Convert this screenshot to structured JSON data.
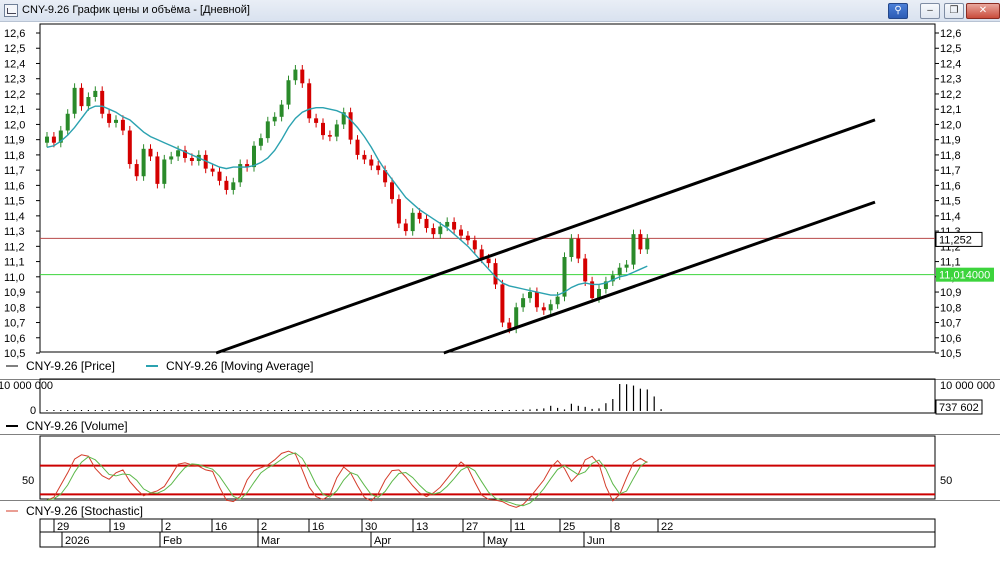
{
  "window": {
    "title": "CNY-9.26 График цены и объёма - [Дневной]",
    "buttons": {
      "pin": "⚲",
      "min": "–",
      "restore": "❐",
      "close": "✕"
    }
  },
  "colors": {
    "up": "#2a8a2a",
    "down": "#d40000",
    "ma": "#2ba2b0",
    "price_line": "#b84a4a",
    "level_line": "#3cd43c",
    "channel": "#000000",
    "stoch_k": "#d43c2a",
    "stoch_d": "#5cb84a",
    "stoch_bands": "#cc0000"
  },
  "price_panel": {
    "y_ticks": [
      "12,6",
      "12,5",
      "12,4",
      "12,3",
      "12,2",
      "12,1",
      "12,0",
      "11,9",
      "11,8",
      "11,7",
      "11,6",
      "11,5",
      "11,4",
      "11,3",
      "11,2",
      "11,1",
      "11,0",
      "10,9",
      "10,8",
      "10,7",
      "10,6",
      "10,5"
    ],
    "last_price_label": "11,252",
    "last_price": 11.252,
    "level_label": "11,014000",
    "level": 11.014,
    "ylim": [
      10.5,
      12.6
    ],
    "legend_price": "CNY-9.26 [Price]",
    "legend_ma": "CNY-9.26 [Moving Average]"
  },
  "volume_panel": {
    "top_label": "10 000 000",
    "zero_label": "0",
    "right_top_label": "10 000 000",
    "last_volume_label": "737 602",
    "legend": "CNY-9.26 [Volume]"
  },
  "stoch_panel": {
    "left_label": "50",
    "right_label": "50",
    "bands": [
      70,
      30
    ],
    "legend": "CNY-9.26 [Stochastic]"
  },
  "date_axis": {
    "days": [
      "29",
      "19",
      "2",
      "16",
      "2",
      "16",
      "30",
      "13",
      "27",
      "11",
      "25",
      "8",
      "22"
    ],
    "months": [
      "2026",
      "Feb",
      "Mar",
      "Apr",
      "May",
      "Jun"
    ]
  },
  "chart_data": {
    "type": "candlestick",
    "x_unit": "trading day",
    "closes": [
      11.92,
      11.88,
      11.96,
      12.07,
      12.24,
      12.12,
      12.18,
      12.22,
      12.07,
      12.01,
      12.03,
      11.96,
      11.74,
      11.66,
      11.84,
      11.79,
      11.61,
      11.77,
      11.79,
      11.83,
      11.78,
      11.76,
      11.8,
      11.71,
      11.69,
      11.63,
      11.57,
      11.62,
      11.74,
      11.72,
      11.86,
      11.91,
      12.02,
      12.05,
      12.13,
      12.29,
      12.36,
      12.27,
      12.04,
      12.01,
      11.93,
      11.92,
      12.0,
      12.08,
      11.9,
      11.8,
      11.77,
      11.73,
      11.7,
      11.62,
      11.51,
      11.35,
      11.3,
      11.42,
      11.38,
      11.32,
      11.28,
      11.33,
      11.36,
      11.31,
      11.27,
      11.24,
      11.18,
      11.12,
      11.09,
      10.95,
      10.7,
      10.66,
      10.8,
      10.86,
      10.9,
      10.8,
      10.78,
      10.82,
      10.87,
      11.13,
      11.25,
      11.12,
      10.97,
      10.86,
      10.92,
      10.97,
      11.01,
      11.06,
      11.08,
      11.28,
      11.18,
      11.25
    ],
    "moving_average": [
      11.85,
      11.86,
      11.89,
      11.93,
      11.98,
      12.04,
      12.1,
      12.12,
      12.12,
      12.1,
      12.08,
      12.05,
      12.03,
      11.99,
      11.95,
      11.92,
      11.9,
      11.88,
      11.86,
      11.84,
      11.82,
      11.8,
      11.78,
      11.76,
      11.74,
      11.72,
      11.71,
      11.72,
      11.72,
      11.72,
      11.73,
      11.75,
      11.78,
      11.83,
      11.9,
      11.98,
      12.04,
      12.08,
      12.1,
      12.11,
      12.11,
      12.1,
      12.09,
      12.07,
      12.03,
      11.98,
      11.92,
      11.85,
      11.77,
      11.7,
      11.64,
      11.58,
      11.52,
      11.48,
      11.44,
      11.41,
      11.38,
      11.35,
      11.32,
      11.28,
      11.24,
      11.2,
      11.15,
      11.1,
      11.05,
      11.0,
      10.96,
      10.94,
      10.93,
      10.92,
      10.91,
      10.9,
      10.89,
      10.88,
      10.88,
      10.9,
      10.93,
      10.95,
      10.96,
      10.95,
      10.95,
      10.96,
      10.98,
      11.0,
      11.01,
      11.03,
      11.05,
      11.07
    ],
    "channel_upper": [
      [
        24.5,
        10.5
      ],
      [
        120,
        12.03
      ]
    ],
    "channel_lower": [
      [
        57.5,
        10.5
      ],
      [
        120,
        11.49
      ]
    ],
    "volume": [
      0,
      0,
      0,
      0,
      0,
      0,
      0,
      0,
      0,
      0,
      0,
      0,
      0,
      0,
      0,
      0,
      0,
      0,
      0,
      0,
      0,
      0,
      0,
      0,
      0,
      0,
      0,
      0,
      0,
      0,
      0,
      0,
      0,
      0,
      0,
      0,
      0,
      0,
      0,
      0,
      0,
      0,
      0,
      0,
      0,
      0,
      0,
      0,
      0,
      0,
      0,
      0.2,
      0.2,
      0.2,
      0.2,
      0.2,
      0.2,
      0.2,
      0.2,
      0.2,
      0.2,
      0.3,
      0.3,
      0.3,
      0.3,
      0.3,
      0.3,
      0.3,
      0.4,
      0.5,
      0.6,
      0.8,
      1.0,
      2.0,
      1.2,
      0.6,
      2.8,
      2.0,
      1.6,
      0.8,
      1.0,
      3.0,
      4.6,
      10.4,
      10.3,
      9.8,
      8.6,
      8.3,
      5.6,
      0.7
    ],
    "stochastic_k": [
      22,
      26,
      43,
      60,
      79,
      85,
      83,
      66,
      56,
      51,
      60,
      64,
      48,
      37,
      28,
      32,
      35,
      41,
      56,
      72,
      74,
      71,
      69,
      64,
      62,
      40,
      22,
      20,
      27,
      50,
      63,
      67,
      71,
      78,
      87,
      90,
      86,
      64,
      40,
      27,
      23,
      29,
      53,
      68,
      60,
      42,
      26,
      21,
      31,
      50,
      63,
      64,
      54,
      42,
      32,
      27,
      32,
      40,
      52,
      64,
      75,
      67,
      47,
      29,
      23,
      22,
      20,
      15,
      12,
      16,
      26,
      38,
      50,
      67,
      77,
      66,
      48,
      58,
      78,
      83,
      72,
      41,
      21,
      30,
      53,
      74,
      80,
      74
    ]
  }
}
